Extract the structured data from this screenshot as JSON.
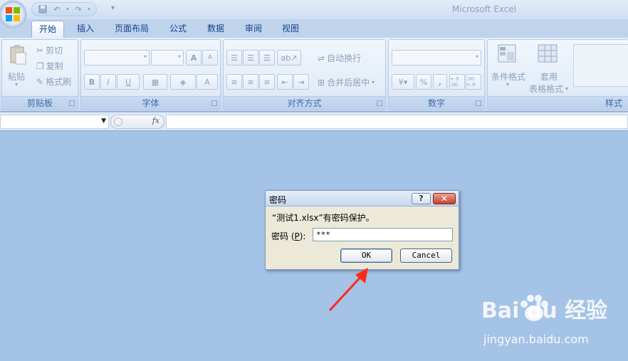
{
  "window": {
    "title": "Microsoft Excel"
  },
  "quick_access": {
    "save_icon": "save-icon",
    "undo_icon": "undo-icon",
    "redo_icon": "redo-icon"
  },
  "tabs": [
    {
      "label": "开始",
      "active": true
    },
    {
      "label": "插入"
    },
    {
      "label": "页面布局"
    },
    {
      "label": "公式"
    },
    {
      "label": "数据"
    },
    {
      "label": "审阅"
    },
    {
      "label": "视图"
    }
  ],
  "ribbon": {
    "clipboard": {
      "label": "剪贴板",
      "paste": "粘贴",
      "cut": "剪切",
      "copy": "复制",
      "format_painter": "格式刷"
    },
    "font": {
      "label": "字体",
      "grow": "A",
      "shrink": "A",
      "bold": "B",
      "italic": "I",
      "underline": "U",
      "font_color": "A"
    },
    "alignment": {
      "label": "对齐方式",
      "wrap_text": "自动换行",
      "merge_center": "合并后居中"
    },
    "number": {
      "label": "数字",
      "percent": "%",
      "comma": ",",
      "inc_decimal": "+.0 .00",
      "dec_decimal": ".00 +.0"
    },
    "styles": {
      "label": "样式",
      "conditional_format": "条件格式",
      "table_format_1": "套用",
      "table_format_2": "表格格式"
    }
  },
  "formula_bar": {
    "fx": "fx"
  },
  "dialog": {
    "title": "密码",
    "help": "?",
    "close": "✕",
    "message": "“测试1.xlsx”有密码保护。",
    "password_label_pre": "密码 (",
    "password_label_key": "P",
    "password_label_post": "):",
    "password_value": "***",
    "ok": "OK",
    "cancel": "Cancel"
  },
  "annotation": {
    "arrow_color": "#ff2a1a"
  },
  "watermark": {
    "brand": "Bai du 经验",
    "url": "jingyan.baidu.com"
  }
}
